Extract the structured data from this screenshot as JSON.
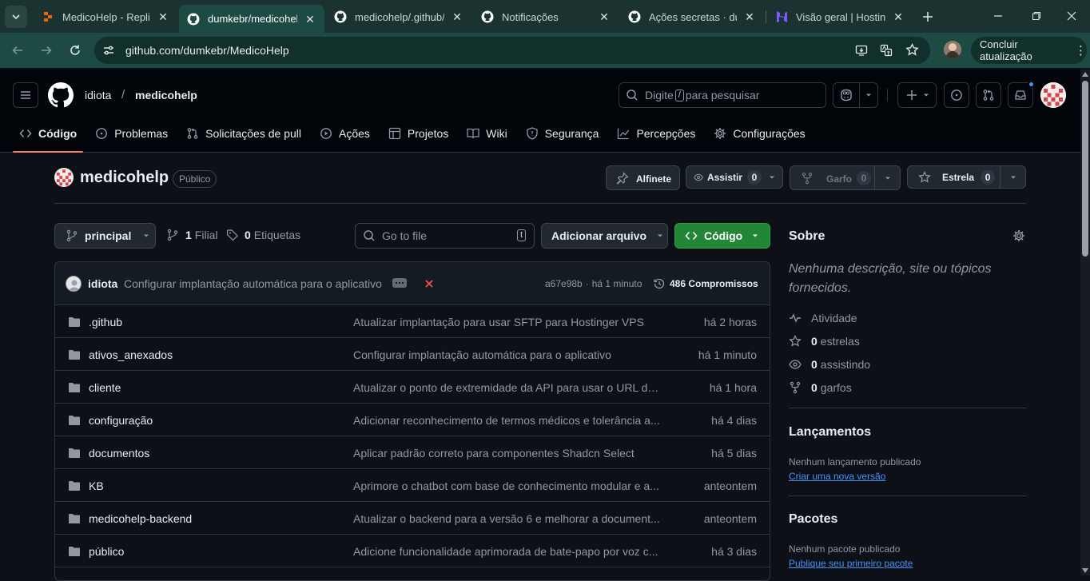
{
  "browser": {
    "tabs": [
      {
        "title": "MedicoHelp - Replit",
        "icon": "replit-icon"
      },
      {
        "title": "dumkebr/medicohelp",
        "icon": "github-icon",
        "active": true
      },
      {
        "title": "medicohelp/.github/w",
        "icon": "github-icon"
      },
      {
        "title": "Notificações",
        "icon": "github-icon"
      },
      {
        "title": "Ações secretas · dum",
        "icon": "github-icon"
      },
      {
        "title": "Visão geral | Hostinge",
        "icon": "hostinger-icon"
      }
    ],
    "url": "github.com/dumkebr/MedicoHelp",
    "update_label": "Concluir atualização"
  },
  "header": {
    "owner": "idiota",
    "separator": "/",
    "repo": "medicohelp",
    "search_before": "Digite",
    "search_key": "/",
    "search_after": "para pesquisar"
  },
  "nav": {
    "tabs": [
      {
        "label": "Código",
        "icon": "code-icon",
        "selected": true
      },
      {
        "label": "Problemas",
        "icon": "issue-icon"
      },
      {
        "label": "Solicitações de pull",
        "icon": "pull-request-icon"
      },
      {
        "label": "Ações",
        "icon": "play-icon"
      },
      {
        "label": "Projetos",
        "icon": "table-icon"
      },
      {
        "label": "Wiki",
        "icon": "book-icon"
      },
      {
        "label": "Segurança",
        "icon": "shield-icon"
      },
      {
        "label": "Percepções",
        "icon": "graph-icon"
      },
      {
        "label": "Configurações",
        "icon": "gear-icon"
      }
    ]
  },
  "repo": {
    "name": "medicohelp",
    "visibility": "Público",
    "pin_label": "Alfinete",
    "watch_label": "Assistir",
    "watch_count": "0",
    "fork_label": "Garfo",
    "fork_count": "0",
    "star_label": "Estrela",
    "star_count": "0"
  },
  "branchbar": {
    "branch": "principal",
    "branches_count": "1",
    "branches_label": "Filial",
    "tags_count": "0",
    "tags_label": "Etiquetas",
    "goto_placeholder": "Go to file",
    "goto_key": "t",
    "add_file_label": "Adicionar arquivo",
    "code_label": "Código"
  },
  "commit": {
    "author": "idiota",
    "message": "Configurar implantação automática para o aplicativo",
    "hash": "a67e98b",
    "dot": "·",
    "time": "há 1 minuto",
    "count_label": "486 Compromissos"
  },
  "files": [
    {
      "name": ".github",
      "message": "Atualizar implantação para usar SFTP para Hostinger VPS",
      "date": "há 2 horas"
    },
    {
      "name": "ativos_anexados",
      "message": "Configurar implantação automática para o aplicativo",
      "date": "há 1 minuto"
    },
    {
      "name": "cliente",
      "message": "Atualizar o ponto de extremidade da API para usar o URL de...",
      "date": "há 1 hora"
    },
    {
      "name": "configuração",
      "message": "Adicionar reconhecimento de termos médicos e tolerância a...",
      "date": "há 4 dias"
    },
    {
      "name": "documentos",
      "message": "Aplicar padrão correto para componentes Shadcn Select",
      "date": "há 5 dias"
    },
    {
      "name": "KB",
      "message": "Aprimore o chatbot com base de conhecimento modular e a...",
      "date": "anteontem"
    },
    {
      "name": "medicohelp-backend",
      "message": "Atualizar o backend para a versão 6 e melhorar a document...",
      "date": "anteontem"
    },
    {
      "name": "público",
      "message": "Adicione funcionalidade aprimorada de bate-papo por voz c...",
      "date": "há 3 dias"
    }
  ],
  "about": {
    "title": "Sobre",
    "description": "Nenhuma descrição, site ou tópicos fornecidos.",
    "activity_label": "Atividade",
    "stars_count": "0",
    "stars_label": "estrelas",
    "watching_count": "0",
    "watching_label": "assistindo",
    "forks_count": "0",
    "forks_label": "garfos"
  },
  "releases": {
    "title": "Lançamentos",
    "empty": "Nenhum lançamento publicado",
    "link": "Criar uma nova versão"
  },
  "packages": {
    "title": "Pacotes",
    "empty": "Nenhum pacote publicado",
    "link": "Publique seu primeiro pacote"
  },
  "colors": {
    "accent_green": "#238636",
    "link_blue": "#4493f8",
    "tab_underline": "#f78166",
    "failure_red": "#f85149"
  }
}
